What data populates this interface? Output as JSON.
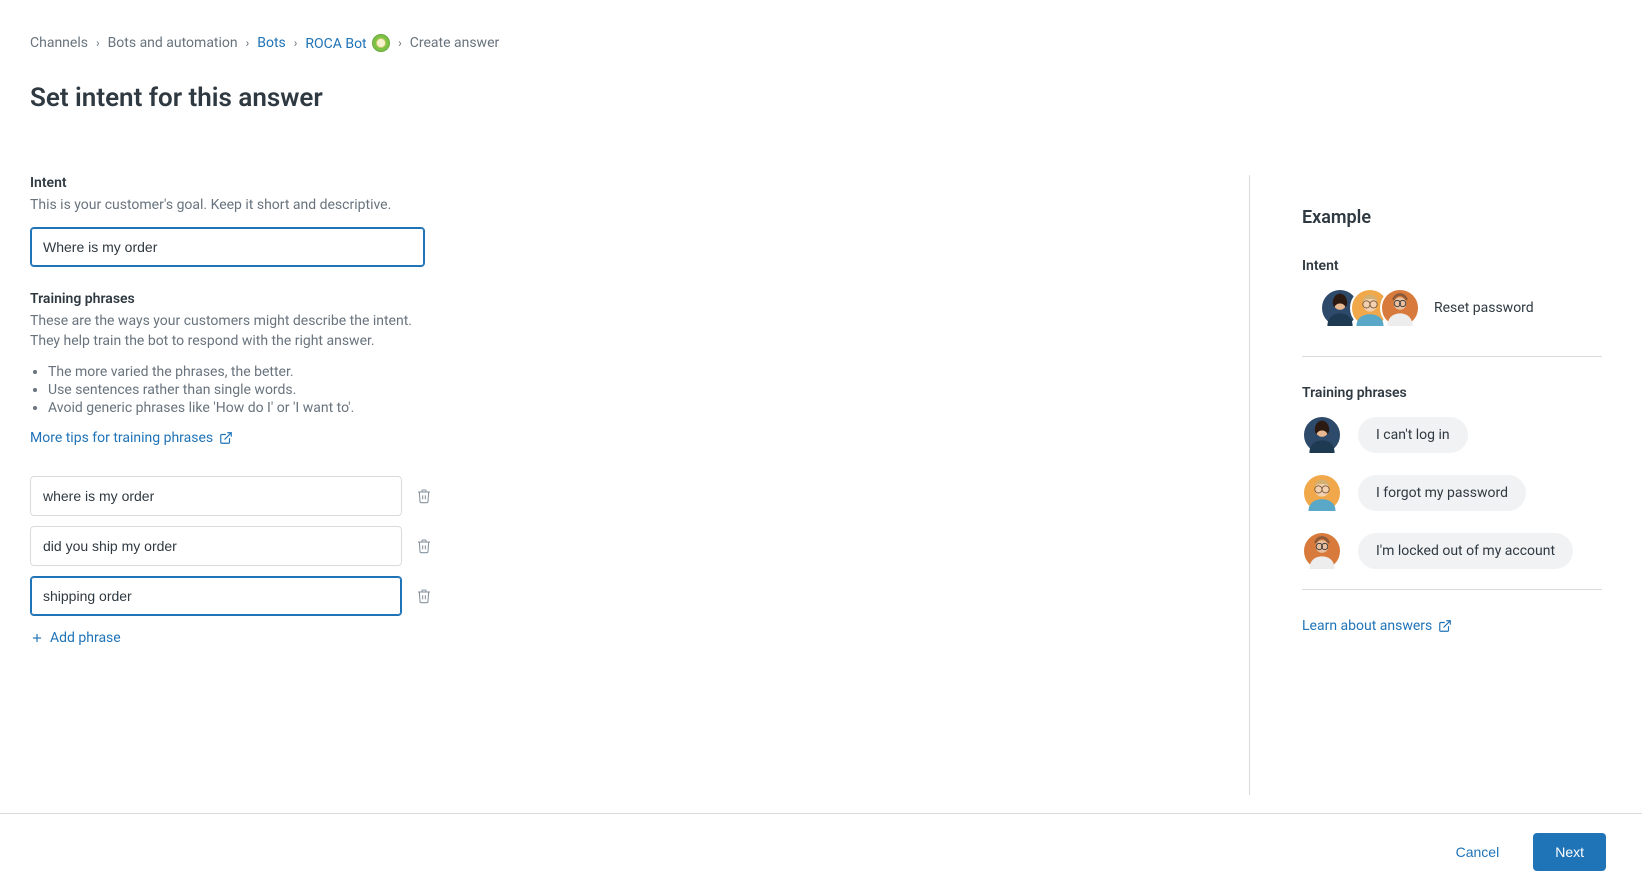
{
  "breadcrumb": {
    "items": [
      {
        "label": "Channels",
        "link": false
      },
      {
        "label": "Bots and automation",
        "link": false
      },
      {
        "label": "Bots",
        "link": true
      },
      {
        "label": "ROCA Bot",
        "link": true,
        "hasEmoji": true
      },
      {
        "label": "Create answer",
        "link": false
      }
    ]
  },
  "page": {
    "title": "Set intent for this answer"
  },
  "intent": {
    "label": "Intent",
    "help": "This is your customer's goal. Keep it short and descriptive.",
    "value": "Where is my order"
  },
  "training": {
    "label": "Training phrases",
    "help": "These are the ways your customers might describe the intent. They help train the bot to respond with the right answer.",
    "tips": [
      "The more varied the phrases, the better.",
      "Use sentences rather than single words.",
      "Avoid generic phrases like 'How do I' or 'I want to'."
    ],
    "more_tips_label": "More tips for training phrases",
    "phrases": [
      "where is my order",
      "did you ship my order",
      "shipping order"
    ],
    "add_label": "Add phrase"
  },
  "example": {
    "heading": "Example",
    "intent_label": "Intent",
    "intent_value": "Reset password",
    "training_label": "Training phrases",
    "phrases": [
      "I can't log in",
      "I forgot my password",
      "I'm locked out of my account"
    ],
    "learn_label": "Learn about answers"
  },
  "footer": {
    "cancel": "Cancel",
    "next": "Next"
  }
}
